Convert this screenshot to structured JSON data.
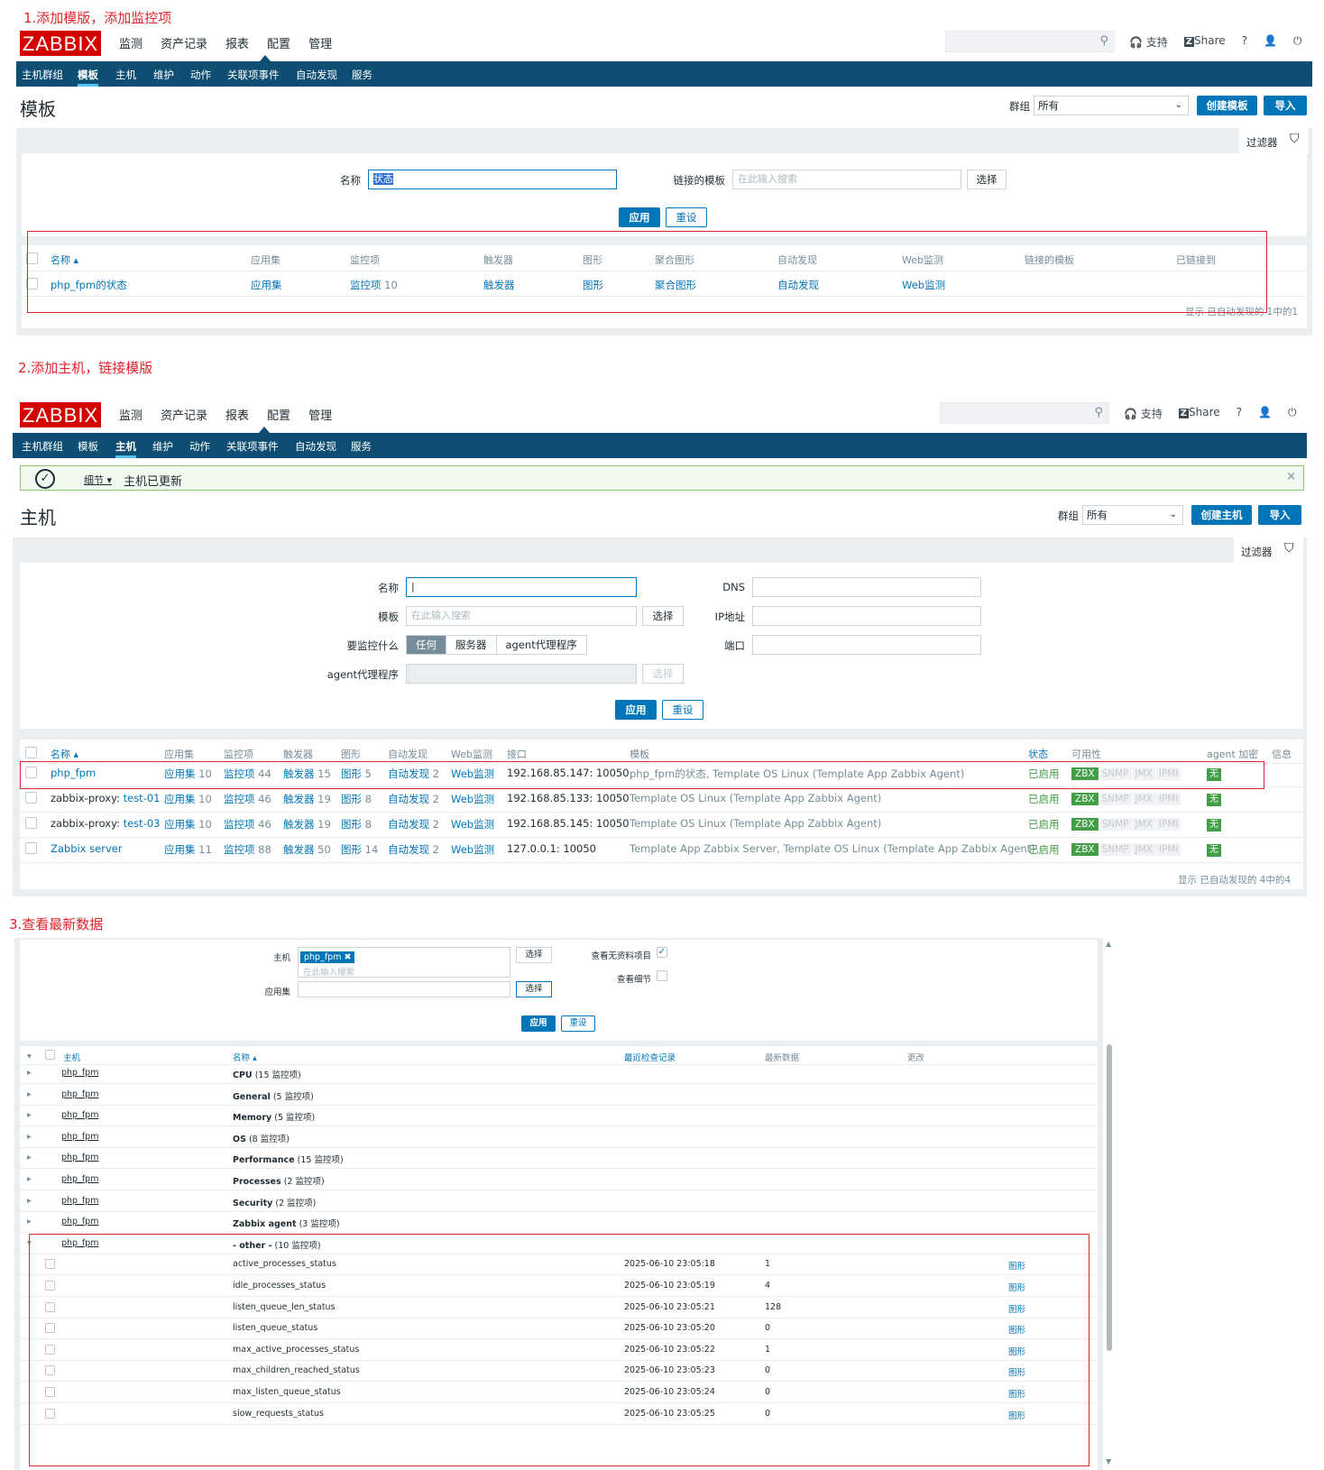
{
  "captions": {
    "s1": "1.添加模版，添加监控项",
    "s2": "2.添加主机，链接模版",
    "s3": "3.查看最新数据"
  },
  "app": {
    "logo": "ZABBIX",
    "main_nav": [
      "监测",
      "资产记录",
      "报表",
      "配置",
      "管理"
    ],
    "tools": {
      "support": "支持",
      "share": "Share",
      "help": "?",
      "share_badge": "Z"
    }
  },
  "sub_nav": [
    "主机群组",
    "模板",
    "主机",
    "维护",
    "动作",
    "关联项事件",
    "自动发现",
    "服务"
  ],
  "templates": {
    "title": "模板",
    "group_label": "群组",
    "group_value": "所有",
    "create_button": "创建模板",
    "import_button": "导入",
    "filter_label": "过滤器",
    "name_label": "名称",
    "name_value": "状态",
    "linked_label": "链接的模板",
    "linked_placeholder": "在此输入搜索",
    "select_button": "选择",
    "apply_button": "应用",
    "reset_button": "重设",
    "columns": [
      "名称 ▴",
      "应用集",
      "监控项",
      "触发器",
      "图形",
      "聚合图形",
      "自动发现",
      "Web监测",
      "链接的模板",
      "已链接到"
    ],
    "row": {
      "name": "php_fpm的状态",
      "apps": "应用集",
      "items": "监控项",
      "items_count": "10",
      "triggers": "触发器",
      "graphs": "图形",
      "screens": "聚合图形",
      "discovery": "自动发现",
      "web": "Web监测"
    },
    "footer": "显示 已自动发现的 1中的1"
  },
  "hosts": {
    "success_details": "细节 ▾",
    "success_msg": "主机已更新",
    "close": "×",
    "title": "主机",
    "group_label": "群组",
    "group_value": "所有",
    "create_button": "创建主机",
    "import_button": "导入",
    "filter_label": "过滤器",
    "name_label": "名称",
    "template_label": "模板",
    "template_placeholder": "在此输入搜索",
    "select_button": "选择",
    "monitor_label": "要监控什么",
    "monitor_opts": [
      "任何",
      "服务器",
      "agent代理程序"
    ],
    "proxy_label": "agent代理程序",
    "proxy_select": "选择",
    "dns_label": "DNS",
    "ip_label": "IP地址",
    "port_label": "端口",
    "apply_button": "应用",
    "reset_button": "重设",
    "columns": [
      "名称 ▴",
      "应用集",
      "监控项",
      "触发器",
      "图形",
      "自动发现",
      "Web监测",
      "接口",
      "模板",
      "状态",
      "可用性",
      "agent 加密",
      "信息"
    ],
    "rows": [
      {
        "name_pre": "",
        "name": "php_fpm",
        "apps": "应用集",
        "apps_n": "10",
        "items": "监控项",
        "items_n": "44",
        "trig": "触发器",
        "trig_n": "15",
        "graphs": "图形",
        "graphs_n": "5",
        "disc": "自动发现",
        "disc_n": "2",
        "web": "Web监测",
        "iface": "192.168.85.147: 10050",
        "tpl": "php_fpm的状态, Template OS Linux (Template App Zabbix Agent)",
        "status": "已启用"
      },
      {
        "name_pre": "zabbix-proxy: ",
        "name": "test-01",
        "apps": "应用集",
        "apps_n": "10",
        "items": "监控项",
        "items_n": "46",
        "trig": "触发器",
        "trig_n": "19",
        "graphs": "图形",
        "graphs_n": "8",
        "disc": "自动发现",
        "disc_n": "2",
        "web": "Web监测",
        "iface": "192.168.85.133: 10050",
        "tpl": "Template OS Linux (Template App Zabbix Agent)",
        "status": "已启用"
      },
      {
        "name_pre": "zabbix-proxy: ",
        "name": "test-03",
        "apps": "应用集",
        "apps_n": "10",
        "items": "监控项",
        "items_n": "46",
        "trig": "触发器",
        "trig_n": "19",
        "graphs": "图形",
        "graphs_n": "8",
        "disc": "自动发现",
        "disc_n": "2",
        "web": "Web监测",
        "iface": "192.168.85.145: 10050",
        "tpl": "Template OS Linux (Template App Zabbix Agent)",
        "status": "已启用"
      },
      {
        "name_pre": "",
        "name": "Zabbix server",
        "apps": "应用集",
        "apps_n": "11",
        "items": "监控项",
        "items_n": "88",
        "trig": "触发器",
        "trig_n": "50",
        "graphs": "图形",
        "graphs_n": "14",
        "disc": "自动发现",
        "disc_n": "2",
        "web": "Web监测",
        "iface": "127.0.0.1: 10050",
        "tpl": "Template App Zabbix Server, Template OS Linux (Template App Zabbix Agent)",
        "status": "已启用"
      }
    ],
    "avail": {
      "zbx": "ZBX",
      "snmp": "SNMP",
      "jmx": "JMX",
      "ipmi": "IPMI",
      "enc": "无"
    },
    "footer": "显示 已自动发现的 4中的4"
  },
  "latest": {
    "host_label": "主机",
    "host_tag": "php_fpm",
    "host_tag_x": "✖",
    "host_placeholder": "在此输入搜索",
    "select_button": "选择",
    "apps_label": "应用集",
    "show_no_data": "查看无资料项目",
    "show_details": "查看细节",
    "apply_button": "应用",
    "reset_button": "重设",
    "columns": {
      "host": "主机",
      "name": "名称 ▴",
      "last_check": "最近检查记录",
      "last_value": "最新数据",
      "change": "更改"
    },
    "groups": [
      {
        "host": "php_fpm",
        "name": "CPU",
        "count": "(15 监控项)"
      },
      {
        "host": "php_fpm",
        "name": "General",
        "count": "(5 监控项)"
      },
      {
        "host": "php_fpm",
        "name": "Memory",
        "count": "(5 监控项)"
      },
      {
        "host": "php_fpm",
        "name": "OS",
        "count": "(8 监控项)"
      },
      {
        "host": "php_fpm",
        "name": "Performance",
        "count": "(15 监控项)"
      },
      {
        "host": "php_fpm",
        "name": "Processes",
        "count": "(2 监控项)"
      },
      {
        "host": "php_fpm",
        "name": "Security",
        "count": "(2 监控项)"
      },
      {
        "host": "php_fpm",
        "name": "Zabbix agent",
        "count": "(3 监控项)"
      },
      {
        "host": "php_fpm",
        "name": "- other -",
        "count": "(10 监控项)"
      }
    ],
    "items": [
      {
        "name": "active_processes_status",
        "time": "2025-06-10 23:05:18",
        "value": "1",
        "graph": "图形"
      },
      {
        "name": "idle_processes_status",
        "time": "2025-06-10 23:05:19",
        "value": "4",
        "graph": "图形"
      },
      {
        "name": "listen_queue_len_status",
        "time": "2025-06-10 23:05:21",
        "value": "128",
        "graph": "图形"
      },
      {
        "name": "listen_queue_status",
        "time": "2025-06-10 23:05:20",
        "value": "0",
        "graph": "图形"
      },
      {
        "name": "max_active_processes_status",
        "time": "2025-06-10 23:05:22",
        "value": "1",
        "graph": "图形"
      },
      {
        "name": "max_children_reached_status",
        "time": "2025-06-10 23:05:23",
        "value": "0",
        "graph": "图形"
      },
      {
        "name": "max_listen_queue_status",
        "time": "2025-06-10 23:05:24",
        "value": "0",
        "graph": "图形"
      },
      {
        "name": "slow_requests_status",
        "time": "2025-06-10 23:05:25",
        "value": "0",
        "graph": "图形"
      }
    ]
  }
}
